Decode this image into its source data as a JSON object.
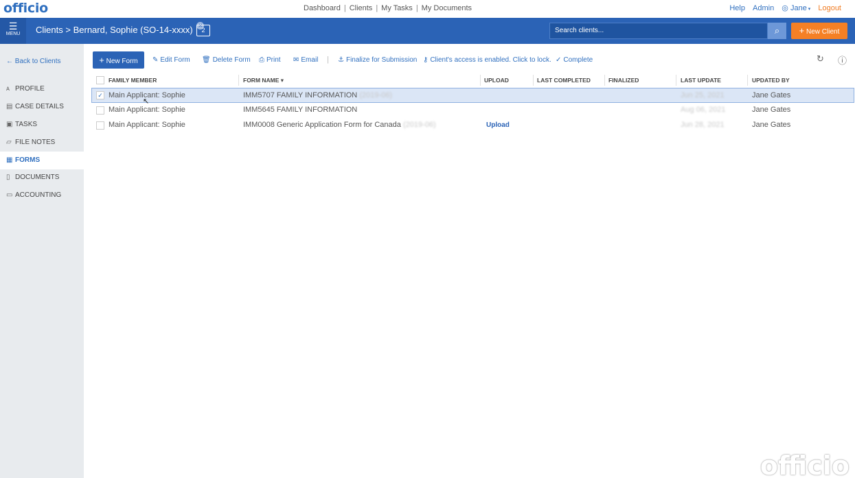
{
  "app": {
    "logo": "officio"
  },
  "topnav": {
    "links": [
      "Dashboard",
      "Clients",
      "My Tasks",
      "My Documents"
    ],
    "help": "Help",
    "admin": "Admin",
    "user": "Jane",
    "logout": "Logout"
  },
  "header": {
    "menu_label": "MENU",
    "breadcrumb_root": "Clients",
    "breadcrumb_sep": ">",
    "breadcrumb_client": "Bernard, Sophie (SO-14-xxxx)",
    "task_count": "2",
    "search_placeholder": "Search clients...",
    "new_client": "New Client"
  },
  "sidebar": {
    "back": "Back to Clients",
    "items": [
      {
        "label": "PROFILE",
        "icon": "person-icon"
      },
      {
        "label": "CASE DETAILS",
        "icon": "id-card-icon"
      },
      {
        "label": "TASKS",
        "icon": "clipboard-icon"
      },
      {
        "label": "FILE NOTES",
        "icon": "note-icon"
      },
      {
        "label": "FORMS",
        "icon": "form-icon",
        "active": true
      },
      {
        "label": "DOCUMENTS",
        "icon": "document-icon"
      },
      {
        "label": "ACCOUNTING",
        "icon": "money-icon"
      }
    ]
  },
  "toolbar": {
    "new_form": "New Form",
    "edit_form": "Edit Form",
    "delete_form": "Delete Form",
    "print": "Print",
    "email": "Email",
    "finalize": "Finalize for Submission",
    "access": "Client's access is enabled. Click to lock.",
    "complete": "Complete"
  },
  "table": {
    "columns": [
      "FAMILY MEMBER",
      "FORM NAME",
      "UPLOAD",
      "LAST COMPLETED",
      "FINALIZED",
      "LAST UPDATE",
      "UPDATED BY"
    ],
    "rows": [
      {
        "member": "Main Applicant: Sophie",
        "form": "IMM5707 FAMILY INFORMATION",
        "version": "(2019-06)",
        "upload": "",
        "last_update": "Jun 25, 2021",
        "updated_by": "Jane Gates",
        "selected": true
      },
      {
        "member": "Main Applicant: Sophie",
        "form": "IMM5645 FAMILY INFORMATION",
        "version": "",
        "upload": "",
        "last_update": "Aug 06, 2021",
        "updated_by": "Jane Gates",
        "selected": false
      },
      {
        "member": "Main Applicant: Sophie",
        "form": "IMM0008 Generic Application Form for Canada",
        "version": "(2019-06)",
        "upload": "Upload",
        "last_update": "Jun 28, 2021",
        "updated_by": "Jane Gates",
        "selected": false
      }
    ]
  },
  "watermark": "officio"
}
